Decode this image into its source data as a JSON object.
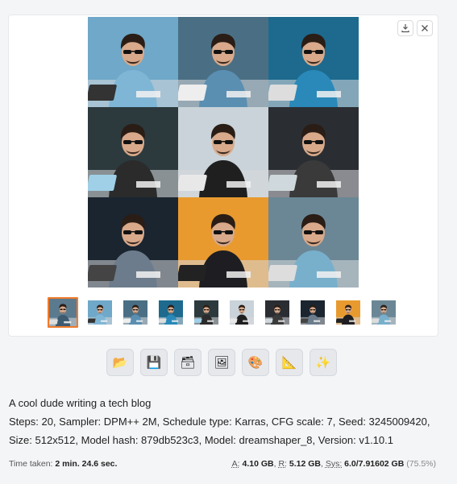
{
  "gallery": {
    "download_label": "download",
    "close_label": "close",
    "images": [
      {
        "bg": "#6fa8c8",
        "shirt": "#7fb6d6",
        "screen": "#333"
      },
      {
        "bg": "#4a6f84",
        "shirt": "#5a8fb2",
        "screen": "#eee"
      },
      {
        "bg": "#1d6a8e",
        "shirt": "#2a89b9",
        "screen": "#ddd"
      },
      {
        "bg": "#2c3a3e",
        "shirt": "#2b2b2b",
        "screen": "#9fd0e8"
      },
      {
        "bg": "#c9d3d9",
        "shirt": "#1f1f1f",
        "screen": "#e8e8e8"
      },
      {
        "bg": "#2a2e33",
        "shirt": "#3a3a3a",
        "screen": "#cfd8dc"
      },
      {
        "bg": "#1a2530",
        "shirt": "#6c7c8c",
        "screen": "#444"
      },
      {
        "bg": "#e89a2f",
        "shirt": "#1e1e22",
        "screen": "#222"
      },
      {
        "bg": "#6b8796",
        "shirt": "#78b0cc",
        "screen": "#ddd"
      }
    ],
    "thumbnail_count": 10,
    "selected_index": 0
  },
  "tools": [
    {
      "name": "open-folder-button",
      "icon": "folder-icon",
      "glyph": "📂"
    },
    {
      "name": "save-button",
      "icon": "save-icon",
      "glyph": "💾"
    },
    {
      "name": "zip-button",
      "icon": "archive-icon",
      "glyph": "🗃"
    },
    {
      "name": "send-to-img2img-button",
      "icon": "image-icon",
      "glyph": "🖼"
    },
    {
      "name": "send-to-inpaint-button",
      "icon": "palette-icon",
      "glyph": "🎨"
    },
    {
      "name": "send-to-extras-button",
      "icon": "ruler-icon",
      "glyph": "📐"
    },
    {
      "name": "send-to-extras-sparkle-button",
      "icon": "sparkle-icon",
      "glyph": "✨"
    }
  ],
  "caption": {
    "prompt": "A cool dude writing a tech blog",
    "params": "Steps: 20, Sampler: DPM++ 2M, Schedule type: Karras, CFG scale: 7, Seed: 3245009420, Size: 512x512, Model hash: 879db523c3, Model: dreamshaper_8, Version: v1.10.1"
  },
  "status": {
    "time_label": "Time taken:",
    "time_value": "2 min. 24.6 sec.",
    "a_label": "A:",
    "a_value": "4.10 GB",
    "r_label": "R:",
    "r_value": "5.12 GB",
    "sys_label": "Sys:",
    "sys_value": "6.0/7.91602 GB",
    "sys_pct": "(75.5%)"
  }
}
